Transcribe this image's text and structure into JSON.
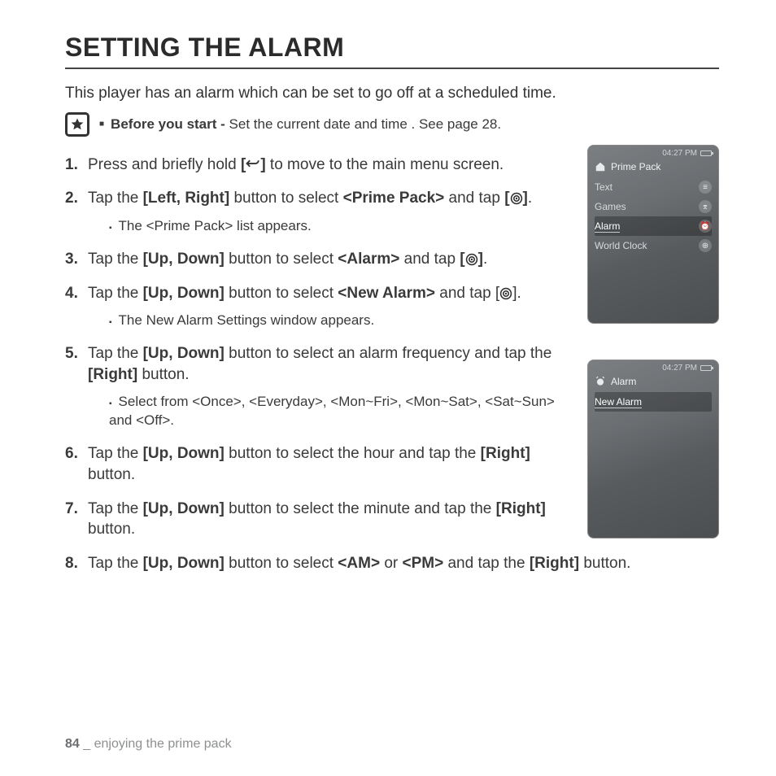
{
  "title": "SETTING THE ALARM",
  "intro": "This player has an alarm which can be set to go off at a scheduled time.",
  "note": {
    "lead": "Before you start - ",
    "body": "Set the current date and time . See page 28."
  },
  "steps": {
    "s1": {
      "n": "1.",
      "a": "Press and briefly hold ",
      "b": "[",
      "c": "]",
      "d": " to move to the main menu screen."
    },
    "s2": {
      "n": "2.",
      "a": "Tap the ",
      "b": "[Left, Right]",
      "c": " button to select ",
      "d": "<Prime Pack>",
      "e": " and tap ",
      "f": "[",
      "g": "]",
      "h": ".",
      "sub": "The <Prime Pack> list appears."
    },
    "s3": {
      "n": "3.",
      "a": "Tap the ",
      "b": "[Up, Down]",
      "c": " button to select ",
      "d": "<Alarm>",
      "e": " and tap ",
      "f": "[",
      "g": "]",
      "h": "."
    },
    "s4": {
      "n": "4.",
      "a": "Tap the ",
      "b": "[Up, Down]",
      "c": " button to select ",
      "d": "<New Alarm>",
      "e": " and tap [",
      "f": "].",
      "sub": "The New Alarm Settings window appears."
    },
    "s5": {
      "n": "5.",
      "a": "Tap the ",
      "b": "[Up, Down]",
      "c": " button to select an alarm frequency and tap the ",
      "d": "[Right]",
      "e": " button.",
      "sub": "Select from <Once>, <Everyday>, <Mon~Fri>, <Mon~Sat>, <Sat~Sun> and <Off>."
    },
    "s6": {
      "n": "6.",
      "a": "Tap the ",
      "b": "[Up, Down]",
      "c": " button to select the hour and tap the ",
      "d": "[Right]",
      "e": " button."
    },
    "s7": {
      "n": "7.",
      "a": "Tap the ",
      "b": "[Up, Down]",
      "c": " button to select the minute and tap the ",
      "d": "[Right]",
      "e": " button."
    },
    "s8": {
      "n": "8.",
      "a": "Tap the ",
      "b": "[Up, Down]",
      "c": " button to select ",
      "d": "<AM>",
      "e": " or ",
      "f": "<PM>",
      "g": " and tap the ",
      "h": "[Right]",
      "i": " button."
    }
  },
  "device1": {
    "time": "04:27 PM",
    "header": "Prime Pack",
    "items": [
      {
        "label": "Text",
        "icon": "text-icon"
      },
      {
        "label": "Games",
        "icon": "games-icon"
      },
      {
        "label": "Alarm",
        "icon": "alarm-icon",
        "selected": true
      },
      {
        "label": "World Clock",
        "icon": "globe-icon"
      }
    ]
  },
  "device2": {
    "time": "04:27 PM",
    "header": "Alarm",
    "items": [
      {
        "label": "New Alarm",
        "selected": true
      }
    ]
  },
  "footer": {
    "page": "84",
    "sep": " _ ",
    "chapter": "enjoying the prime pack"
  }
}
